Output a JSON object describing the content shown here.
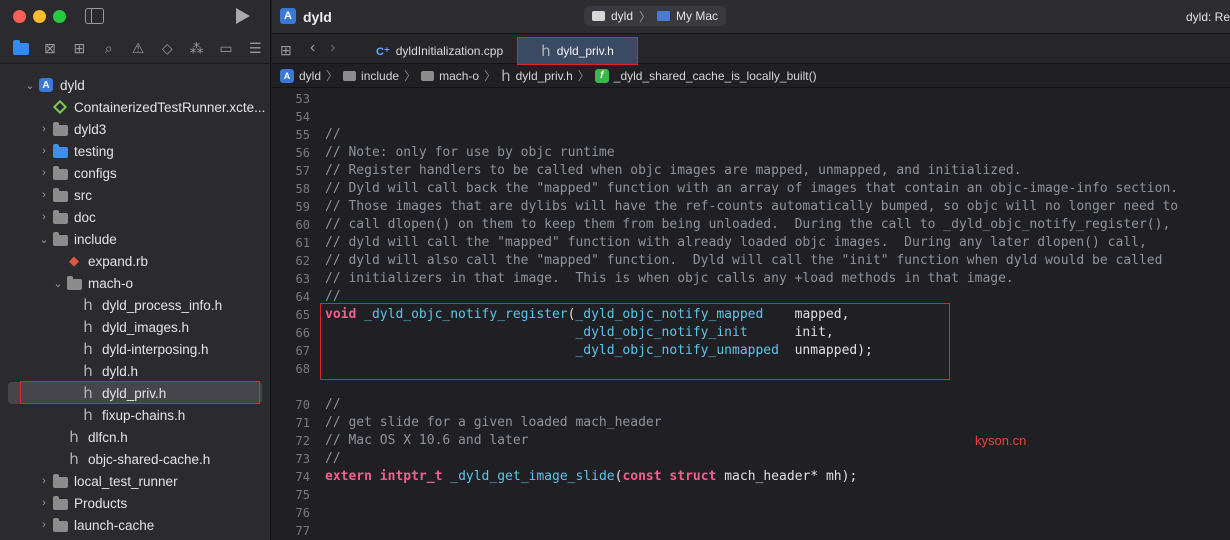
{
  "window": {
    "title": "dyld",
    "scheme": {
      "target": "dyld",
      "destination": "My Mac"
    },
    "status": "dyld: Rea"
  },
  "navigator": {
    "tree": [
      {
        "label": "dyld",
        "icon": "project-icon",
        "depth": 0,
        "expanded": true
      },
      {
        "label": "ContainerizedTestRunner.xcte...",
        "icon": "test-plan-icon",
        "depth": 1,
        "expanded": null
      },
      {
        "label": "dyld3",
        "icon": "folder-icon",
        "depth": 1,
        "expanded": false
      },
      {
        "label": "testing",
        "icon": "blue-folder-icon",
        "depth": 1,
        "expanded": false
      },
      {
        "label": "configs",
        "icon": "folder-icon",
        "depth": 1,
        "expanded": false
      },
      {
        "label": "src",
        "icon": "folder-icon",
        "depth": 1,
        "expanded": false
      },
      {
        "label": "doc",
        "icon": "folder-icon",
        "depth": 1,
        "expanded": false
      },
      {
        "label": "include",
        "icon": "folder-icon",
        "depth": 1,
        "expanded": true
      },
      {
        "label": "expand.rb",
        "icon": "ruby-file-icon",
        "depth": 2,
        "expanded": null
      },
      {
        "label": "mach-o",
        "icon": "folder-icon",
        "depth": 2,
        "expanded": true
      },
      {
        "label": "dyld_process_info.h",
        "icon": "header-file-icon",
        "depth": 3,
        "expanded": null
      },
      {
        "label": "dyld_images.h",
        "icon": "header-file-icon",
        "depth": 3,
        "expanded": null
      },
      {
        "label": "dyld-interposing.h",
        "icon": "header-file-icon",
        "depth": 3,
        "expanded": null
      },
      {
        "label": "dyld.h",
        "icon": "header-file-icon",
        "depth": 3,
        "expanded": null
      },
      {
        "label": "dyld_priv.h",
        "icon": "header-file-icon",
        "depth": 3,
        "expanded": null,
        "selected": true
      },
      {
        "label": "fixup-chains.h",
        "icon": "header-file-icon",
        "depth": 3,
        "expanded": null
      },
      {
        "label": "dlfcn.h",
        "icon": "header-file-icon",
        "depth": 2,
        "expanded": null
      },
      {
        "label": "objc-shared-cache.h",
        "icon": "header-file-icon",
        "depth": 2,
        "expanded": null
      },
      {
        "label": "local_test_runner",
        "icon": "folder-icon",
        "depth": 1,
        "expanded": false
      },
      {
        "label": "Products",
        "icon": "folder-icon",
        "depth": 1,
        "expanded": false
      },
      {
        "label": "launch-cache",
        "icon": "folder-icon",
        "depth": 1,
        "expanded": false
      }
    ]
  },
  "tabs": [
    {
      "label": "dyldInitialization.cpp",
      "icon": "cpp-file-icon",
      "active": false
    },
    {
      "label": "dyld_priv.h",
      "icon": "header-file-icon",
      "active": true
    }
  ],
  "jumpbar": {
    "items": [
      "dyld",
      "include",
      "mach-o",
      "dyld_priv.h",
      "_dyld_shared_cache_is_locally_built()"
    ]
  },
  "editor": {
    "lines": [
      {
        "n": "53",
        "t": []
      },
      {
        "n": "54",
        "t": []
      },
      {
        "n": "55",
        "t": [
          [
            "cmt",
            "//"
          ]
        ]
      },
      {
        "n": "56",
        "t": [
          [
            "cmt",
            "// Note: only for use by objc runtime"
          ]
        ]
      },
      {
        "n": "57",
        "t": [
          [
            "cmt",
            "// Register handlers to be called when objc images are mapped, unmapped, and initialized."
          ]
        ]
      },
      {
        "n": "58",
        "t": [
          [
            "cmt",
            "// Dyld will call back the \"mapped\" function with an array of images that contain an objc-image-info section."
          ]
        ]
      },
      {
        "n": "59",
        "t": [
          [
            "cmt",
            "// Those images that are dylibs will have the ref-counts automatically bumped, so objc will no longer need to"
          ]
        ]
      },
      {
        "n": "60",
        "t": [
          [
            "cmt",
            "// call dlopen() on them to keep them from being unloaded.  During the call to _dyld_objc_notify_register(),"
          ]
        ]
      },
      {
        "n": "61",
        "t": [
          [
            "cmt",
            "// dyld will call the \"mapped\" function with already loaded objc images.  During any later dlopen() call,"
          ]
        ]
      },
      {
        "n": "62",
        "t": [
          [
            "cmt",
            "// dyld will also call the \"mapped\" function.  Dyld will call the \"init\" function when dyld would be called"
          ]
        ]
      },
      {
        "n": "63",
        "t": [
          [
            "cmt",
            "// initializers in that image.  This is when objc calls any +load methods in that image."
          ]
        ]
      },
      {
        "n": "64",
        "t": [
          [
            "cmt",
            "//"
          ]
        ]
      },
      {
        "n": "65",
        "t": [
          [
            "kw",
            "void"
          ],
          [
            "ty",
            " "
          ],
          [
            "fn",
            "_dyld_objc_notify_register"
          ],
          [
            "ty",
            "("
          ],
          [
            "fn",
            "_dyld_objc_notify_mapped"
          ],
          [
            "ty",
            "    mapped,"
          ]
        ]
      },
      {
        "n": "66",
        "t": [
          [
            "ty",
            "                                "
          ],
          [
            "fn",
            "_dyld_objc_notify_init"
          ],
          [
            "ty",
            "      init,"
          ]
        ]
      },
      {
        "n": "67",
        "t": [
          [
            "ty",
            "                                "
          ],
          [
            "fn",
            "_dyld_objc_notify_unmapped"
          ],
          [
            "ty",
            "  unmapped);"
          ]
        ]
      },
      {
        "n": "68",
        "t": []
      },
      {
        "n": "70",
        "t": [
          [
            "cmt",
            "//"
          ]
        ]
      },
      {
        "n": "71",
        "t": [
          [
            "cmt",
            "// get slide for a given loaded mach_header"
          ]
        ]
      },
      {
        "n": "72",
        "t": [
          [
            "cmt",
            "// Mac OS X 10.6 and later"
          ]
        ]
      },
      {
        "n": "73",
        "t": [
          [
            "cmt",
            "//"
          ]
        ]
      },
      {
        "n": "74",
        "t": [
          [
            "kw",
            "extern"
          ],
          [
            "ty",
            " "
          ],
          [
            "kw",
            "intptr_t"
          ],
          [
            "ty",
            " "
          ],
          [
            "fn",
            "_dyld_get_image_slide"
          ],
          [
            "ty",
            "("
          ],
          [
            "kw",
            "const"
          ],
          [
            "ty",
            " "
          ],
          [
            "kw",
            "struct"
          ],
          [
            "ty",
            " mach_header* mh);"
          ]
        ]
      },
      {
        "n": "75",
        "t": []
      },
      {
        "n": "76",
        "t": []
      },
      {
        "n": "77",
        "t": []
      }
    ]
  },
  "watermark": "kyson.cn",
  "colors": {
    "highlight_box": "#d8262b",
    "keyword": "#f2608d",
    "function": "#5cc6e8",
    "comment": "#8e949c",
    "selection": "#46454b"
  }
}
